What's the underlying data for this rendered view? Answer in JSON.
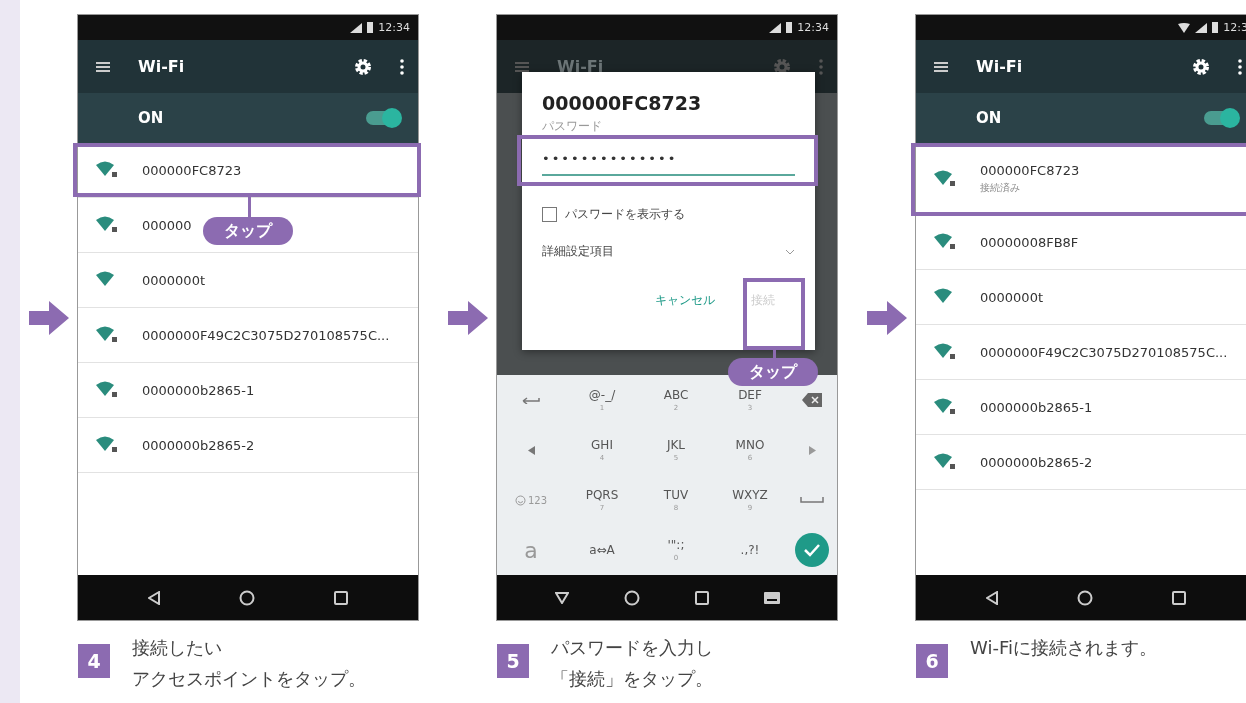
{
  "steps": [
    {
      "number": "4",
      "caption_lines": [
        "接続したい",
        "アクセスポイントをタップ。"
      ],
      "phone": {
        "kind": "list",
        "status": {
          "time": "12:34"
        },
        "app_bar": {
          "title": "Wi-Fi"
        },
        "switch": {
          "label": "ON",
          "on": true
        },
        "networks": [
          {
            "name": "000000FC8723",
            "secured": true,
            "highlighted": true
          },
          {
            "name": "000000",
            "secured": true,
            "highlighted": false
          },
          {
            "name": "0000000t",
            "secured": false,
            "highlighted": false
          },
          {
            "name": "0000000F49C2C3075D270108575C...",
            "secured": true,
            "highlighted": false
          },
          {
            "name": "0000000b2865-1",
            "secured": true,
            "highlighted": false
          },
          {
            "name": "0000000b2865-2",
            "secured": true,
            "highlighted": false
          }
        ],
        "callout": "タップ"
      }
    },
    {
      "number": "5",
      "caption_lines": [
        "パスワードを入力し",
        "「接続」をタップ。"
      ],
      "phone": {
        "kind": "dialog",
        "status": {
          "time": "12:34"
        },
        "app_bar": {
          "title": "Wi-Fi"
        },
        "dialog": {
          "title": "000000FC8723",
          "field_label": "パスワード",
          "value": "••••••••••••••",
          "checkbox": {
            "label": "パスワードを表示する",
            "checked": false
          },
          "advanced": {
            "label": "詳細設定項目",
            "expanded": false
          },
          "buttons": [
            {
              "label": "キャンセル",
              "disabled": false,
              "highlighted": false
            },
            {
              "label": "接続",
              "disabled": true,
              "highlighted": true
            }
          ]
        },
        "callout": "タップ",
        "keyboard": [
          [
            {
              "kind": "undo"
            },
            {
              "kind": "text",
              "label": "@-_/",
              "sub": "1"
            },
            {
              "kind": "text",
              "label": "ABC",
              "sub": "2"
            },
            {
              "kind": "text",
              "label": "DEF",
              "sub": "3"
            },
            {
              "kind": "backspace"
            }
          ],
          [
            {
              "kind": "left"
            },
            {
              "kind": "text",
              "label": "GHI",
              "sub": "4"
            },
            {
              "kind": "text",
              "label": "JKL",
              "sub": "5"
            },
            {
              "kind": "text",
              "label": "MNO",
              "sub": "6"
            },
            {
              "kind": "right"
            }
          ],
          [
            {
              "kind": "emoji",
              "label": "123"
            },
            {
              "kind": "text",
              "label": "PQRS",
              "sub": "7"
            },
            {
              "kind": "text",
              "label": "TUV",
              "sub": "8"
            },
            {
              "kind": "text",
              "label": "WXYZ",
              "sub": "9"
            },
            {
              "kind": "space"
            }
          ],
          [
            {
              "kind": "big",
              "label": "a"
            },
            {
              "kind": "text",
              "label": "a⇔A"
            },
            {
              "kind": "text",
              "label": "'\":;",
              "sub": "0"
            },
            {
              "kind": "text",
              "label": ".,?!"
            },
            {
              "kind": "enter"
            }
          ]
        ]
      }
    },
    {
      "number": "6",
      "caption_lines": [
        "Wi-Fiに接続されます。"
      ],
      "phone": {
        "kind": "list",
        "status": {
          "time": "12:3",
          "wifi": true
        },
        "app_bar": {
          "title": "Wi-Fi"
        },
        "switch": {
          "label": "ON",
          "on": true
        },
        "networks": [
          {
            "name": "000000FC8723",
            "subtitle": "接続済み",
            "secured": true,
            "highlighted": true
          },
          {
            "name": "00000008FB8F",
            "secured": true,
            "highlighted": false
          },
          {
            "name": "0000000t",
            "secured": false,
            "highlighted": false
          },
          {
            "name": "0000000F49C2C3075D270108575C...",
            "secured": true,
            "highlighted": false
          },
          {
            "name": "0000000b2865-1",
            "secured": true,
            "highlighted": false
          },
          {
            "name": "0000000b2865-2",
            "secured": true,
            "highlighted": false
          }
        ]
      }
    }
  ]
}
